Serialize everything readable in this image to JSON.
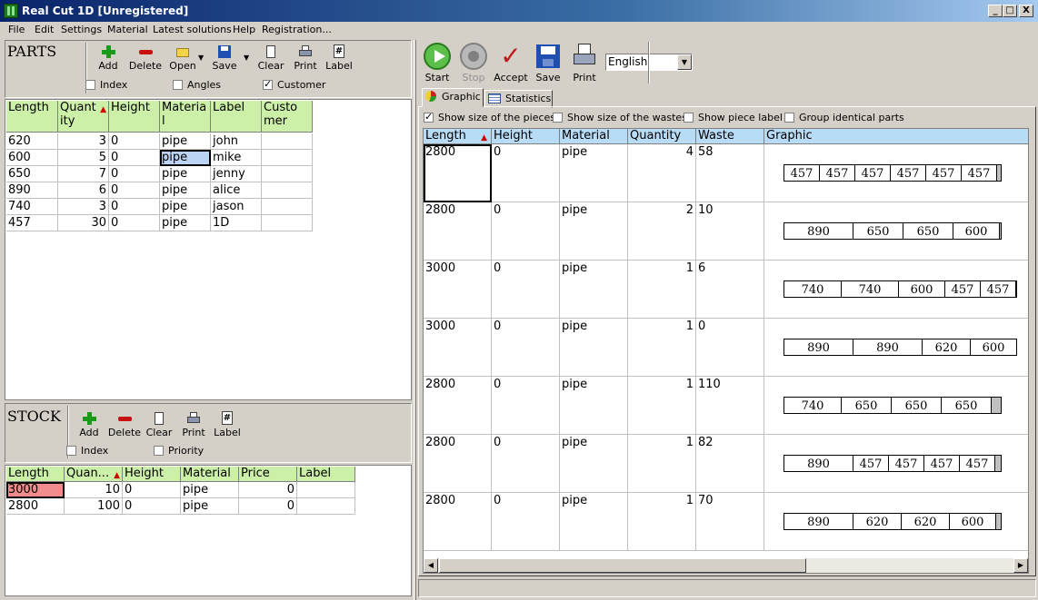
{
  "window": {
    "title": "Real Cut 1D [Unregistered]",
    "min": "_",
    "max": "□",
    "close": "X"
  },
  "menu": [
    "File",
    "Edit",
    "Settings",
    "Material",
    "Latest solutions",
    "Help",
    "Registration..."
  ],
  "parts": {
    "title": "PARTS",
    "toolbar": {
      "add": "Add",
      "delete": "Delete",
      "open": "Open",
      "save": "Save",
      "clear": "Clear",
      "print": "Print",
      "label": "Label"
    },
    "options": {
      "index": "Index",
      "angles": "Angles",
      "customer": "Customer"
    },
    "columns": [
      "Length",
      "Quant ity",
      "Height",
      "Materia l",
      "Label",
      "Custo mer"
    ],
    "rows": [
      [
        "620",
        "3",
        "0",
        "pipe",
        "john",
        ""
      ],
      [
        "600",
        "5",
        "0",
        "pipe",
        "mike",
        ""
      ],
      [
        "650",
        "7",
        "0",
        "pipe",
        "jenny",
        ""
      ],
      [
        "890",
        "6",
        "0",
        "pipe",
        "alice",
        ""
      ],
      [
        "740",
        "3",
        "0",
        "pipe",
        "jason",
        ""
      ],
      [
        "457",
        "30",
        "0",
        "pipe",
        "1D",
        ""
      ]
    ]
  },
  "stock": {
    "title": "STOCK",
    "toolbar": {
      "add": "Add",
      "delete": "Delete",
      "clear": "Clear",
      "print": "Print",
      "label": "Label"
    },
    "options": {
      "index": "Index",
      "priority": "Priority"
    },
    "columns": [
      "Length",
      "Quan...",
      "Height",
      "Material",
      "Price",
      "Label"
    ],
    "rows": [
      [
        "3000",
        "10",
        "0",
        "pipe",
        "0",
        ""
      ],
      [
        "2800",
        "100",
        "0",
        "pipe",
        "0",
        ""
      ]
    ]
  },
  "right": {
    "toolbar": {
      "start": "Start",
      "stop": "Stop",
      "accept": "Accept",
      "save": "Save",
      "print": "Print"
    },
    "language": "English",
    "tabs": {
      "graphic": "Graphic",
      "statistics": "Statistics"
    },
    "options": {
      "size_pieces": "Show size of the pieces",
      "size_wastes": "Show size of the wastes",
      "piece_label": "Show piece label",
      "group": "Group identical parts"
    },
    "columns": [
      "Length",
      "Height",
      "Material",
      "Quantity",
      "Waste",
      "Graphic"
    ],
    "rows": [
      {
        "length": "2800",
        "height": "0",
        "material": "pipe",
        "quantity": "4",
        "waste": "58",
        "pieces": [
          "457",
          "457",
          "457",
          "457",
          "457",
          "457"
        ]
      },
      {
        "length": "2800",
        "height": "0",
        "material": "pipe",
        "quantity": "2",
        "waste": "10",
        "pieces": [
          "890",
          "650",
          "650",
          "600"
        ]
      },
      {
        "length": "3000",
        "height": "0",
        "material": "pipe",
        "quantity": "1",
        "waste": "6",
        "pieces": [
          "740",
          "740",
          "600",
          "457",
          "457"
        ]
      },
      {
        "length": "3000",
        "height": "0",
        "material": "pipe",
        "quantity": "1",
        "waste": "0",
        "pieces": [
          "890",
          "890",
          "620",
          "600"
        ]
      },
      {
        "length": "2800",
        "height": "0",
        "material": "pipe",
        "quantity": "1",
        "waste": "110",
        "pieces": [
          "740",
          "650",
          "650",
          "650"
        ]
      },
      {
        "length": "2800",
        "height": "0",
        "material": "pipe",
        "quantity": "1",
        "waste": "82",
        "pieces": [
          "890",
          "457",
          "457",
          "457",
          "457"
        ]
      },
      {
        "length": "2800",
        "height": "0",
        "material": "pipe",
        "quantity": "1",
        "waste": "70",
        "pieces": [
          "890",
          "620",
          "620",
          "600"
        ]
      }
    ]
  }
}
